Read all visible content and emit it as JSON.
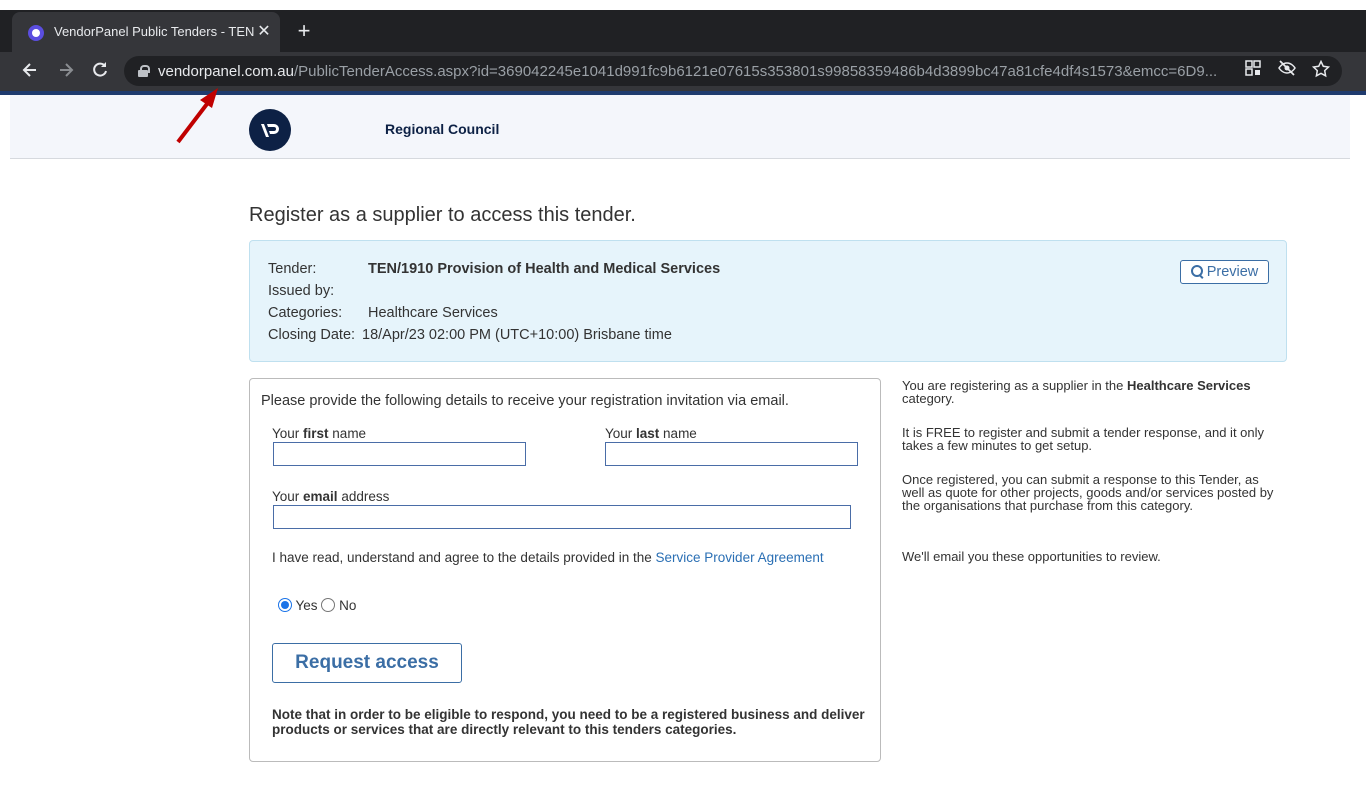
{
  "browser": {
    "tab_title": "VendorPanel Public Tenders - TEN",
    "tab_close": "✕",
    "new_tab": "+",
    "url_domain": "vendorpanel.com.au",
    "url_path": "/PublicTenderAccess.aspx?id=369042245e1041d991fc9b6121e07615s353801s99858359486b4d3899bc47a81cfe4df4s1573&emcc=6D9...",
    "icons": [
      "back-icon",
      "forward-icon",
      "reload-icon",
      "lock-icon",
      "qr-code-icon",
      "eye-off-icon",
      "star-icon"
    ]
  },
  "header": {
    "org_name": "Regional Council"
  },
  "page": {
    "title": "Register as a supplier to access this tender."
  },
  "tender": {
    "tender_label": "Tender:",
    "tender_value": "TEN/1910 Provision of Health and Medical Services",
    "issued_label": "Issued by:",
    "issued_value": "",
    "categories_label": "Categories:",
    "categories_value": "Healthcare Services",
    "closing_label": "Closing Date:",
    "closing_value": "18/Apr/23 02:00 PM (UTC+10:00) Brisbane time",
    "preview_label": "Preview"
  },
  "form": {
    "intro": "Please provide the following details to receive your registration invitation via email.",
    "first_prefix": "Your ",
    "first_bold": "first",
    "first_suffix": " name",
    "last_prefix": "Your ",
    "last_bold": "last",
    "last_suffix": " name",
    "email_prefix": "Your ",
    "email_bold": "email",
    "email_suffix": " address",
    "first_value": "",
    "last_value": "",
    "email_value": "",
    "agree_text": "I have read, understand and agree to the details provided in the ",
    "agree_link": "Service Provider Agreement",
    "yes_label": "Yes",
    "no_label": "No",
    "yes_selected": true,
    "submit_label": "Request access",
    "note": "Note that in order to be eligible to respond, you need to be a registered business and deliver products or services that are directly relevant to this tenders categories."
  },
  "sidebar": {
    "p1_prefix": "You are registering as a supplier in the ",
    "p1_bold": "Healthcare Services",
    "p1_suffix": " category.",
    "p2": "It is FREE to register and submit a tender response, and it only takes a few minutes to get setup.",
    "p3": "Once registered, you can submit a response to this Tender, as well as quote for other projects, goods and/or services posted by the organisations that purchase from this category.",
    "p4": "We'll email you these opportunities to review."
  },
  "colors": {
    "accent": "#3b6ea5",
    "link": "#2a6fb4",
    "tender_bg": "#e6f4fb",
    "logo_bg": "#0d2145",
    "annotation_arrow": "#c00000"
  }
}
